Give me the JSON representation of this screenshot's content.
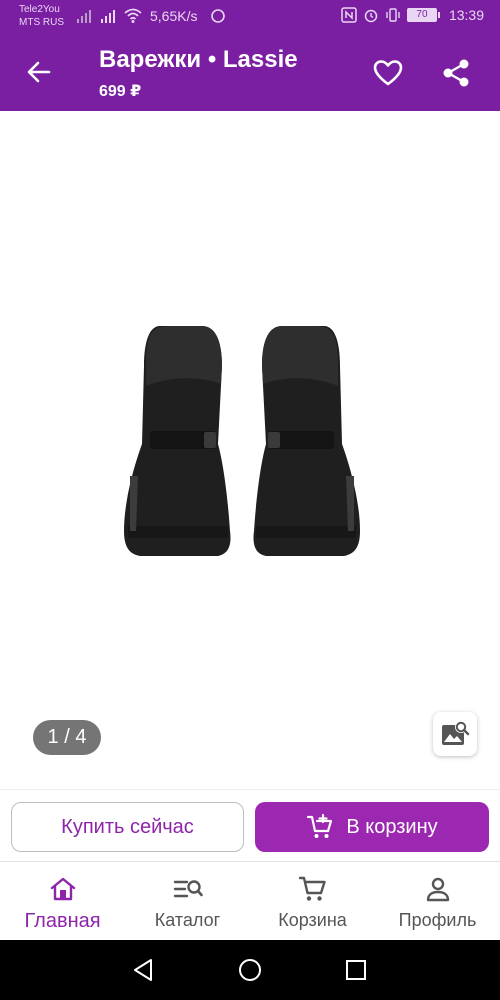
{
  "status_bar": {
    "carrier_1": "Tele2You",
    "carrier_2": "MTS RUS",
    "speed": "5,65K/s",
    "battery": "70",
    "time": "13:39"
  },
  "app_bar": {
    "title": "Варежки • Lassie",
    "price": "699 ₽"
  },
  "gallery": {
    "page_indicator": "1 / 4",
    "current_page": 1,
    "total_pages": 4
  },
  "actions": {
    "buy_now": "Купить сейчас",
    "add_to_cart": "В корзину"
  },
  "bottom_nav": {
    "items": [
      {
        "label": "Главная",
        "icon": "home-icon",
        "active": true
      },
      {
        "label": "Каталог",
        "icon": "catalog-search-icon",
        "active": false
      },
      {
        "label": "Корзина",
        "icon": "cart-icon",
        "active": false
      },
      {
        "label": "Профиль",
        "icon": "profile-icon",
        "active": false
      }
    ]
  },
  "colors": {
    "brand": "#7b1fa2",
    "accent": "#9c27b0",
    "accent_text": "#8e24aa"
  }
}
